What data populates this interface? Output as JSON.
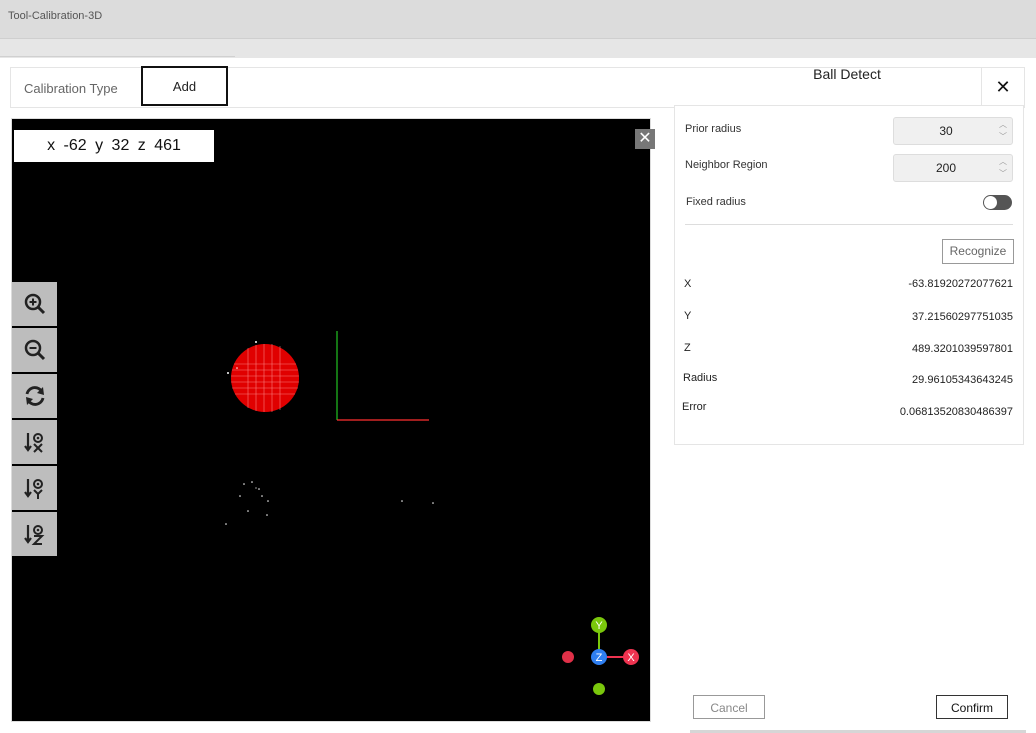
{
  "window": {
    "title": "Tool-Calibration-3D"
  },
  "tabs": {
    "type_label": "Calibration Type",
    "add_label": "Add",
    "close_glyph": "✕"
  },
  "viewer": {
    "coord_readout": "x -62   y 32   z 461",
    "close_glyph": "✕",
    "tools": [
      {
        "name": "zoom-in-icon"
      },
      {
        "name": "zoom-out-icon"
      },
      {
        "name": "refresh-icon"
      },
      {
        "name": "sort-x-icon"
      },
      {
        "name": "sort-y-icon"
      },
      {
        "name": "sort-z-icon"
      }
    ],
    "axis_labels": {
      "y": "Y",
      "z": "Z",
      "x": "X"
    },
    "colors": {
      "ball": "#e00000",
      "axis_x": "#ff3030",
      "axis_y": "#22c322",
      "gizmo_y": "#7ac70c",
      "gizmo_z": "#2f7ff0",
      "gizmo_x": "#ee3350"
    }
  },
  "ball_detect": {
    "title": "Ball Detect",
    "prior_radius_label": "Prior radius",
    "prior_radius_value": "30",
    "neighbor_region_label": "Neighbor Region",
    "neighbor_region_value": "200",
    "fixed_radius_label": "Fixed radius",
    "fixed_radius_on": false,
    "recognize_label": "Recognize",
    "results": [
      {
        "label": "X",
        "value": "-63.81920272077621"
      },
      {
        "label": "Y",
        "value": "37.21560297751035"
      },
      {
        "label": "Z",
        "value": "489.3201039597801"
      },
      {
        "label": "Radius",
        "value": "29.96105343643245"
      },
      {
        "label": "Error",
        "value": "0.06813520830486397"
      }
    ]
  },
  "footer": {
    "cancel_label": "Cancel",
    "confirm_label": "Confirm"
  }
}
